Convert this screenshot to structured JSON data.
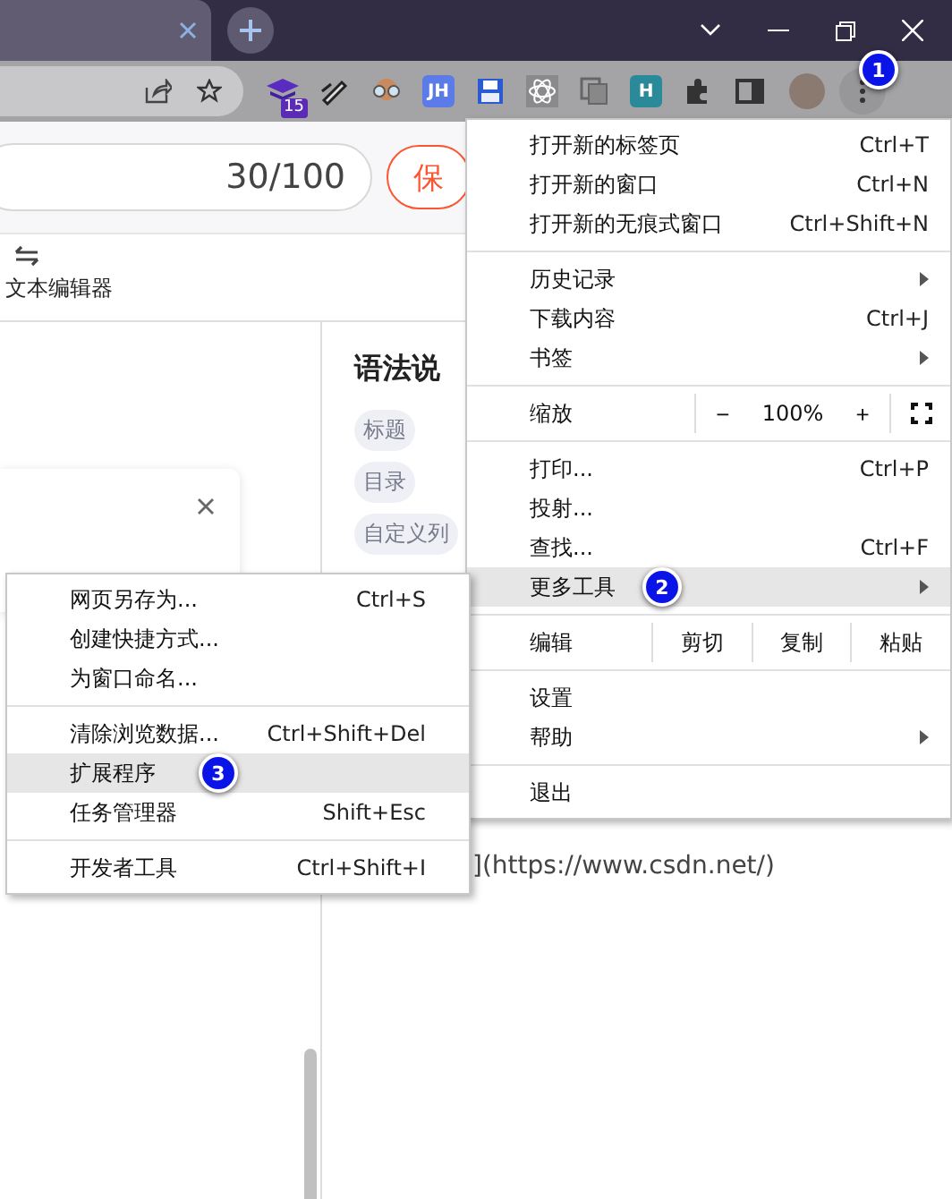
{
  "toolbar": {
    "extensions": [
      {
        "kind": "stack",
        "badge": "15"
      },
      {
        "kind": "pen"
      },
      {
        "kind": "glasses"
      },
      {
        "kind": "letters",
        "label": "JH",
        "color": "#5b7be8"
      },
      {
        "kind": "floppy"
      },
      {
        "kind": "atom"
      },
      {
        "kind": "copy"
      },
      {
        "kind": "letters",
        "label": "H",
        "color": "#2a8a9a"
      },
      {
        "kind": "puzzle"
      },
      {
        "kind": "sidepanel"
      }
    ],
    "marker": "1"
  },
  "editor": {
    "counter": "30/100",
    "save_button": "保",
    "mode_label": "文本编辑器"
  },
  "syntax_panel": {
    "title": "语法说",
    "tags": [
      "标题",
      "目录",
      "自定义列"
    ],
    "link_text": "](https://www.csdn.net/)"
  },
  "main_menu": [
    {
      "kind": "item",
      "label": "打开新的标签页",
      "shortcut": "Ctrl+T",
      "submenu": false,
      "selected": false
    },
    {
      "kind": "item",
      "label": "打开新的窗口",
      "shortcut": "Ctrl+N",
      "submenu": false,
      "selected": false
    },
    {
      "kind": "item",
      "label": "打开新的无痕式窗口",
      "shortcut": "Ctrl+Shift+N",
      "submenu": false,
      "selected": false
    },
    {
      "kind": "separator"
    },
    {
      "kind": "item",
      "label": "历史记录",
      "submenu": true,
      "selected": false
    },
    {
      "kind": "item",
      "label": "下载内容",
      "shortcut": "Ctrl+J",
      "submenu": false,
      "selected": false
    },
    {
      "kind": "item",
      "label": "书签",
      "submenu": true,
      "selected": false
    },
    {
      "kind": "separator"
    },
    {
      "kind": "zoom",
      "label": "缩放",
      "minus": "−",
      "value": "100%",
      "plus": "+"
    },
    {
      "kind": "separator"
    },
    {
      "kind": "item",
      "label": "打印...",
      "shortcut": "Ctrl+P",
      "submenu": false,
      "selected": false
    },
    {
      "kind": "item",
      "label": "投射...",
      "submenu": false,
      "selected": false
    },
    {
      "kind": "item",
      "label": "查找...",
      "shortcut": "Ctrl+F",
      "submenu": false,
      "selected": false
    },
    {
      "kind": "item",
      "label": "更多工具",
      "submenu": true,
      "selected": true,
      "marker": "2"
    },
    {
      "kind": "separator"
    },
    {
      "kind": "edit",
      "label": "编辑",
      "actions": [
        "剪切",
        "复制",
        "粘贴"
      ]
    },
    {
      "kind": "separator"
    },
    {
      "kind": "item",
      "label": "设置",
      "submenu": false,
      "selected": false
    },
    {
      "kind": "item",
      "label": "帮助",
      "submenu": true,
      "selected": false
    },
    {
      "kind": "separator"
    },
    {
      "kind": "item",
      "label": "退出",
      "submenu": false,
      "selected": false
    }
  ],
  "sub_menu": [
    {
      "kind": "item",
      "label": "网页另存为...",
      "shortcut": "Ctrl+S",
      "selected": false
    },
    {
      "kind": "item",
      "label": "创建快捷方式...",
      "selected": false
    },
    {
      "kind": "item",
      "label": "为窗口命名...",
      "selected": false
    },
    {
      "kind": "separator"
    },
    {
      "kind": "item",
      "label": "清除浏览数据...",
      "shortcut": "Ctrl+Shift+Del",
      "selected": false
    },
    {
      "kind": "item",
      "label": "扩展程序",
      "selected": true,
      "marker": "3"
    },
    {
      "kind": "item",
      "label": "任务管理器",
      "shortcut": "Shift+Esc",
      "selected": false
    },
    {
      "kind": "separator"
    },
    {
      "kind": "item",
      "label": "开发者工具",
      "shortcut": "Ctrl+Shift+I",
      "selected": false
    }
  ]
}
